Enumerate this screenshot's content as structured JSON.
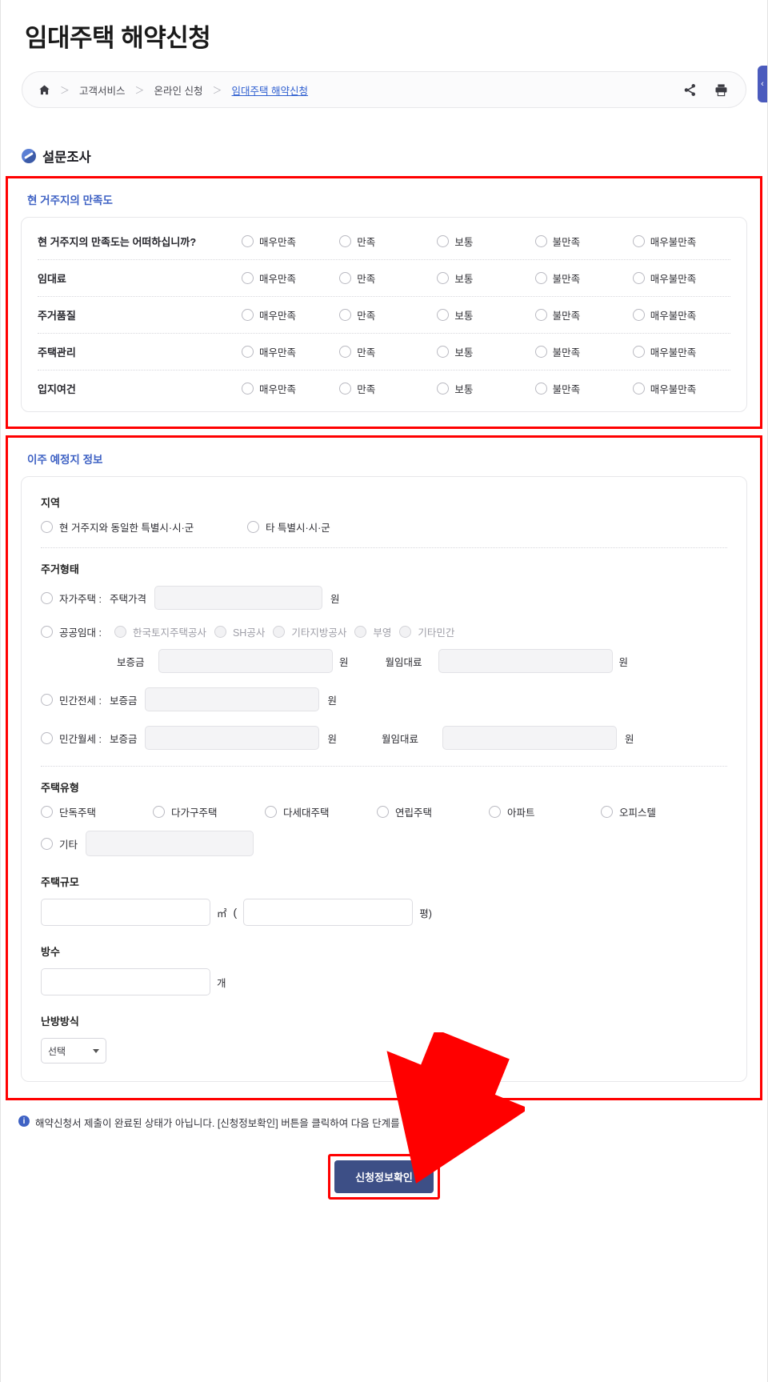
{
  "header": {
    "title": "임대주택 해약신청",
    "breadcrumb": {
      "home_icon": "home-icon",
      "separator": "＞",
      "items": [
        "고객서비스",
        "온라인 신청",
        "임대주택 해약신청"
      ]
    },
    "actions": [
      {
        "name": "share-icon",
        "label": "공유"
      },
      {
        "name": "print-icon",
        "label": "인쇄"
      }
    ],
    "side_tab_icon": "chevron-left-icon"
  },
  "survey": {
    "heading": "설문조사",
    "heading_icon": "survey-badge-icon",
    "block_title": "현 거주지의 만족도",
    "options": [
      "매우만족",
      "만족",
      "보통",
      "불만족",
      "매우불만족"
    ],
    "rows": [
      {
        "label": "현 거주지의 만족도는 어떠하십니까?"
      },
      {
        "label": "임대료"
      },
      {
        "label": "주거품질"
      },
      {
        "label": "주택관리"
      },
      {
        "label": "입지여건"
      }
    ]
  },
  "moving": {
    "block_title": "이주 예정지 정보",
    "region": {
      "label": "지역",
      "options": [
        "현 거주지와 동일한 특별시·시·군",
        "타 특별시·시·군"
      ]
    },
    "housing_form": {
      "label": "주거형태",
      "own": {
        "radio_label": "자가주택 :",
        "field_label": "주택가격",
        "value": "",
        "unit": "원"
      },
      "public": {
        "radio_label": "공공임대 :",
        "providers": [
          "한국토지주택공사",
          "SH공사",
          "기타지방공사",
          "부영",
          "기타민간"
        ],
        "deposit_label": "보증금",
        "deposit_value": "",
        "deposit_unit": "원",
        "rent_label": "월임대료",
        "rent_value": "",
        "rent_unit": "원"
      },
      "jeonse": {
        "radio_label": "민간전세 :",
        "deposit_label": "보증금",
        "deposit_value": "",
        "deposit_unit": "원"
      },
      "monthly": {
        "radio_label": "민간월세 :",
        "deposit_label": "보증금",
        "deposit_value": "",
        "deposit_unit": "원",
        "rent_label": "월임대료",
        "rent_value": "",
        "rent_unit": "원"
      }
    },
    "house_type": {
      "label": "주택유형",
      "options": [
        "단독주택",
        "다가구주택",
        "다세대주택",
        "연립주택",
        "아파트",
        "오피스텔",
        "기타"
      ],
      "other_value": ""
    },
    "house_size": {
      "label": "주택규모",
      "sqm_value": "",
      "sqm_unit": "㎡",
      "paren_open": "(",
      "pyeong_value": "",
      "pyeong_unit": "평)"
    },
    "rooms": {
      "label": "방수",
      "value": "",
      "unit": "개"
    },
    "heating": {
      "label": "난방방식",
      "selected": "선택",
      "caret_icon": "chevron-down-icon"
    }
  },
  "footer": {
    "notice_icon": "info-icon",
    "notice": "해약신청서 제출이 완료된 상태가 아닙니다. [신청정보확인] 버튼을 클릭하여 다음 단계를 진행해주세요.",
    "submit_label": "신청정보확인"
  },
  "annotations": {
    "highlight_color": "#ff0000",
    "arrow_color": "#ff0000",
    "accent_color": "#3f62c4",
    "button_color": "#3d4f86"
  }
}
